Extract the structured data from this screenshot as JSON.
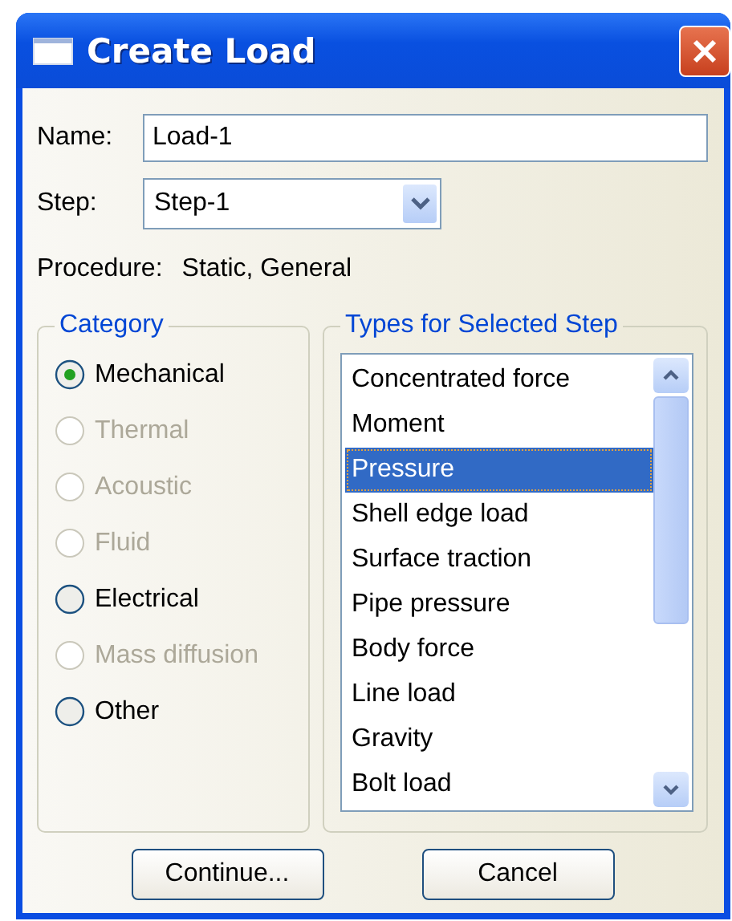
{
  "window": {
    "title": "Create Load"
  },
  "name_field": {
    "label": "Name:",
    "value": "Load-1"
  },
  "step_field": {
    "label": "Step:",
    "value": "Step-1"
  },
  "procedure": {
    "label": "Procedure:",
    "value": "Static, General"
  },
  "category": {
    "title": "Category",
    "options": [
      {
        "label": "Mechanical",
        "selected": true,
        "disabled": false
      },
      {
        "label": "Thermal",
        "selected": false,
        "disabled": true
      },
      {
        "label": "Acoustic",
        "selected": false,
        "disabled": true
      },
      {
        "label": "Fluid",
        "selected": false,
        "disabled": true
      },
      {
        "label": "Electrical",
        "selected": false,
        "disabled": false
      },
      {
        "label": "Mass diffusion",
        "selected": false,
        "disabled": true
      },
      {
        "label": "Other",
        "selected": false,
        "disabled": false
      }
    ]
  },
  "types": {
    "title": "Types for Selected Step",
    "items": [
      {
        "label": "Concentrated force",
        "selected": false
      },
      {
        "label": "Moment",
        "selected": false
      },
      {
        "label": "Pressure",
        "selected": true
      },
      {
        "label": "Shell edge load",
        "selected": false
      },
      {
        "label": "Surface traction",
        "selected": false
      },
      {
        "label": "Pipe pressure",
        "selected": false
      },
      {
        "label": "Body force",
        "selected": false
      },
      {
        "label": "Line load",
        "selected": false
      },
      {
        "label": "Gravity",
        "selected": false
      },
      {
        "label": "Bolt load",
        "selected": false
      }
    ]
  },
  "buttons": [
    "Continue...",
    "Cancel"
  ]
}
